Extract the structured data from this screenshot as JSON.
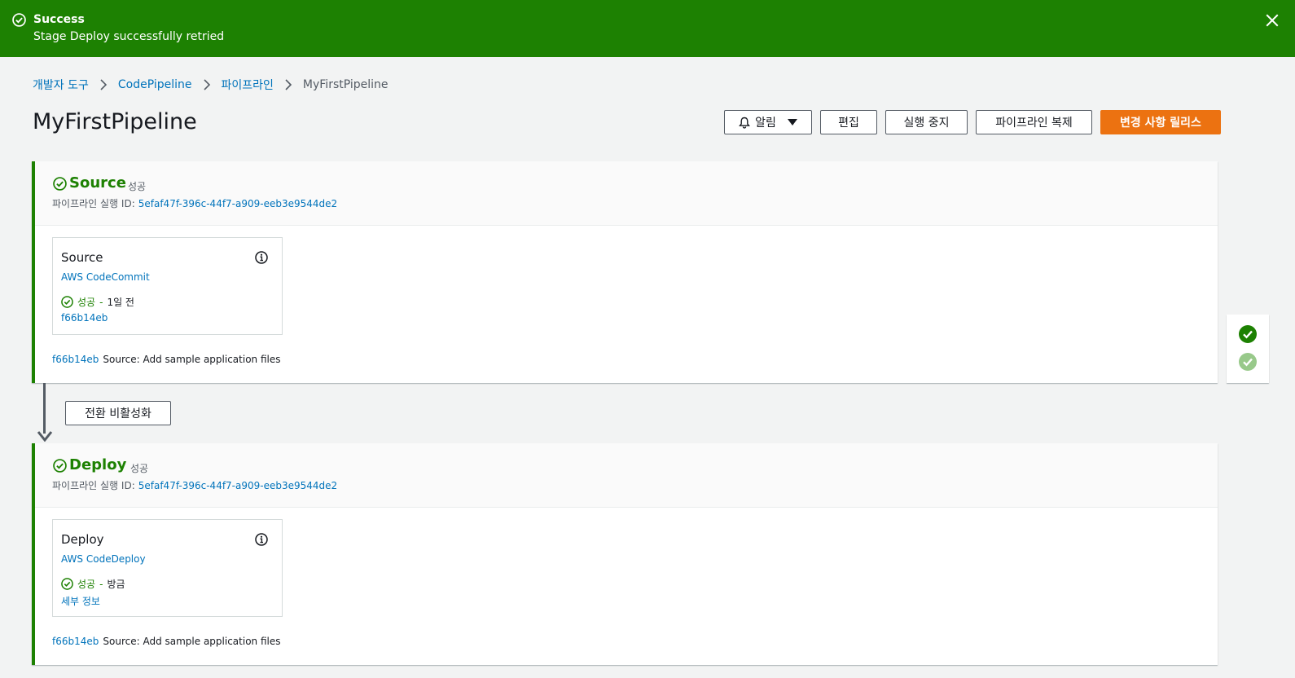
{
  "flash": {
    "title": "Success",
    "message": "Stage Deploy successfully retried"
  },
  "breadcrumb": [
    "개발자 도구",
    "CodePipeline",
    "파이프라인",
    "MyFirstPipeline"
  ],
  "page": {
    "title": "MyFirstPipeline"
  },
  "toolbar": {
    "notify_label": "알림",
    "edit_label": "편집",
    "stop_label": "실행 중지",
    "clone_label": "파이프라인 복제",
    "release_label": "변경 사항 릴리스"
  },
  "stages": [
    {
      "name": "Source",
      "status": "성공",
      "exec_label": "파이프라인 실행 ID:",
      "exec_id": "5efaf47f-396c-44f7-a909-eeb3e9544de2",
      "action": {
        "name": "Source",
        "provider": "AWS CodeCommit",
        "status": "성공",
        "time": "1일 전",
        "link": "f66b14eb"
      },
      "commit_id": "f66b14eb",
      "commit_msg": "Source: Add sample application files"
    },
    {
      "name": "Deploy",
      "status": "성공",
      "exec_label": "파이프라인 실행 ID:",
      "exec_id": "5efaf47f-396c-44f7-a909-eeb3e9544de2",
      "action": {
        "name": "Deploy",
        "provider": "AWS CodeDeploy",
        "status": "성공",
        "time": "방금",
        "link": "세부 정보"
      },
      "commit_id": "f66b14eb",
      "commit_msg": "Source: Add sample application files"
    }
  ],
  "transition": {
    "label": "전환 비활성화"
  },
  "colors": {
    "success": "#1d8102",
    "primary": "#ec7211",
    "link": "#0073bb",
    "success_light": "#98c98a"
  },
  "icons": {
    "flash": "check-circle-icon",
    "close": "close-icon",
    "breadcrumb_separator": "chevron-right-icon",
    "notify": "bell-icon",
    "notify_dropdown": "caret-down-icon",
    "stage_status": "check-circle-icon",
    "action_info": "info-icon",
    "transition": "arrow-down-icon",
    "side_panel": [
      "check-circle-filled-icon",
      "check-circle-filled-light-icon"
    ]
  }
}
